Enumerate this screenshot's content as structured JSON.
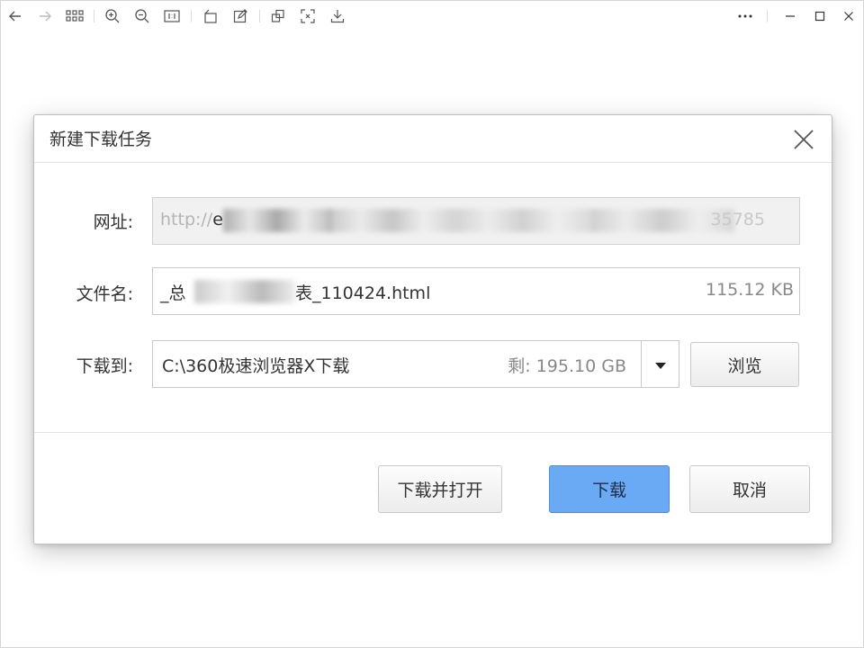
{
  "toolbar": {
    "left_icons": [
      "back-arrow-icon",
      "forward-arrow-icon",
      "grid-icon",
      "zoom-in-icon",
      "zoom-out-icon",
      "actual-size-icon",
      "rotate-icon",
      "edit-icon",
      "crop-icon",
      "fullscreen-icon",
      "download-icon"
    ],
    "right_icons": [
      "more-icon",
      "minimize-icon",
      "maximize-icon",
      "close-icon"
    ]
  },
  "dialog": {
    "title": "新建下载任务",
    "url": {
      "label": "网址:",
      "value_prefix": "http://",
      "value_partial": "e",
      "value_tail": "35785"
    },
    "filename": {
      "label": "文件名:",
      "prefix": "_总",
      "suffix": "表_110424.html",
      "size": "115.12 KB"
    },
    "destination": {
      "label": "下载到:",
      "path": "C:\\360极速浏览器X下载",
      "free_space": "剩: 195.10 GB",
      "browse_label": "浏览"
    },
    "buttons": {
      "download_and_open": "下载并打开",
      "download": "下载",
      "cancel": "取消"
    }
  }
}
